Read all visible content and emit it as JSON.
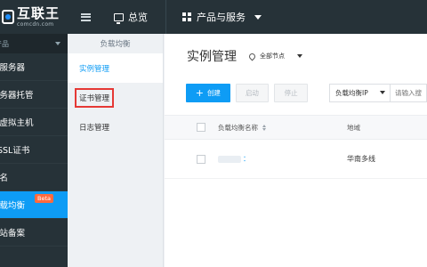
{
  "brand": {
    "name": "互联王",
    "subtitle": "comcdn.com"
  },
  "topnav": {
    "overview_label": "总览",
    "products_label": "产品与服务"
  },
  "sidebar": {
    "group_label": "产品",
    "items": [
      {
        "label": "云服务器"
      },
      {
        "label": "服务器托管"
      },
      {
        "label": "云虚拟主机"
      },
      {
        "label": "SSL证书"
      },
      {
        "label": "域名"
      },
      {
        "label": "负载均衡",
        "badge": "Beta"
      },
      {
        "label": "网站备案"
      }
    ]
  },
  "subsidebar": {
    "title": "负载均衡",
    "items": [
      {
        "label": "实例管理"
      },
      {
        "label": "证书管理"
      },
      {
        "label": "日志管理"
      }
    ]
  },
  "main": {
    "title": "实例管理",
    "region_label": "全部节点",
    "create_label": "创建",
    "start_label": "启动",
    "stop_label": "停止",
    "filter_select": "负载均衡IP",
    "filter_placeholder": "请输入搜",
    "table": {
      "columns": [
        "负载均衡名称",
        "地域"
      ],
      "rows": [
        {
          "name_suffix": "：",
          "region": "华南多线"
        }
      ]
    }
  },
  "colors": {
    "accent": "#0e9cf5",
    "topbar": "#263238",
    "highlight_box": "#e53935"
  }
}
